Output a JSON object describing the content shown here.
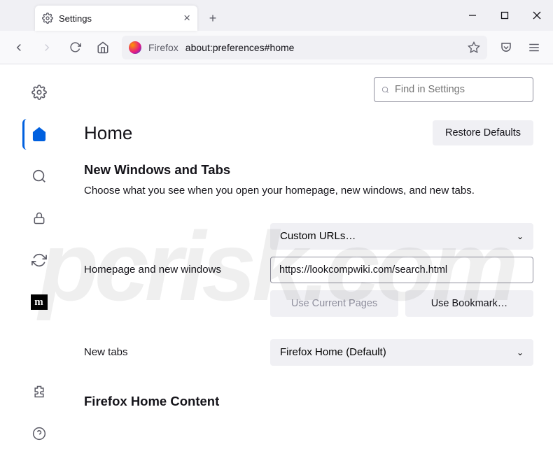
{
  "tab": {
    "title": "Settings"
  },
  "url": {
    "prefix": "Firefox",
    "path": "about:preferences#home"
  },
  "search": {
    "placeholder": "Find in Settings"
  },
  "page": {
    "title": "Home",
    "restore": "Restore Defaults",
    "section": "New Windows and Tabs",
    "desc": "Choose what you see when you open your homepage, new windows, and new tabs.",
    "homepage_label": "Homepage and new windows",
    "homepage_select": "Custom URLs…",
    "homepage_url": "https://lookcompwiki.com/search.html",
    "use_current": "Use Current Pages",
    "use_bookmark": "Use Bookmark…",
    "newtabs_label": "New tabs",
    "newtabs_select": "Firefox Home (Default)",
    "section2": "Firefox Home Content"
  },
  "watermark": "pcrisk.com"
}
